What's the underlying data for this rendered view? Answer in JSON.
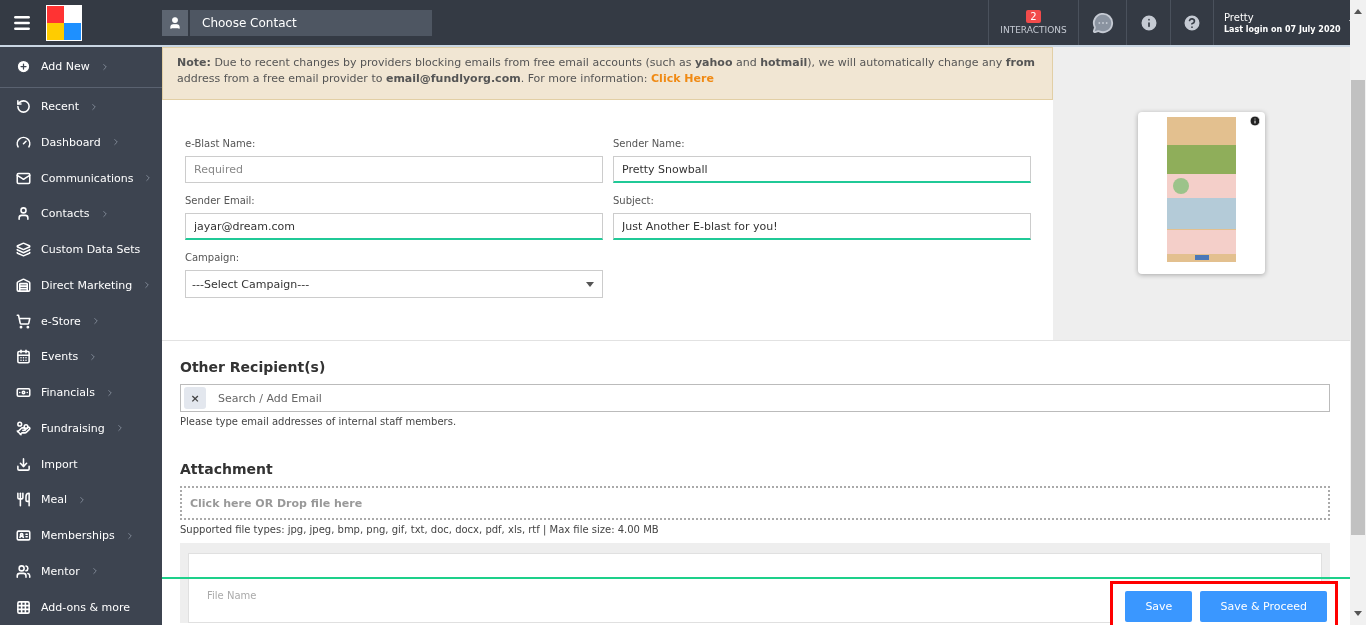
{
  "topbar": {
    "contact_placeholder": "Choose Contact",
    "interactions": {
      "count": "2",
      "label": "INTERACTIONS"
    },
    "user": {
      "name": "Pretty",
      "last_login": "Last login on 07 July 2020"
    }
  },
  "sidebar": {
    "add_new": {
      "label": "Add New",
      "submenu": true
    },
    "items": [
      {
        "label": "Recent",
        "submenu": true
      },
      {
        "label": "Dashboard",
        "submenu": true
      },
      {
        "label": "Communications",
        "submenu": true
      },
      {
        "label": "Contacts",
        "submenu": true
      },
      {
        "label": "Custom Data Sets",
        "submenu": false
      },
      {
        "label": "Direct Marketing",
        "submenu": true
      },
      {
        "label": "e-Store",
        "submenu": true
      },
      {
        "label": "Events",
        "submenu": true
      },
      {
        "label": "Financials",
        "submenu": true
      },
      {
        "label": "Fundraising",
        "submenu": true
      },
      {
        "label": "Import",
        "submenu": false
      },
      {
        "label": "Meal",
        "submenu": true
      },
      {
        "label": "Memberships",
        "submenu": true
      },
      {
        "label": "Mentor",
        "submenu": true
      },
      {
        "label": "Add-ons & more",
        "submenu": false
      }
    ]
  },
  "note": {
    "text": "**Note:** Due to recent changes by providers blocking emails from free email accounts (such as **yahoo** and **hotmail**), we will automatically change any **from** address from a free email provider to **email@fundlyorg.com**. For more information:",
    "link": "Click Here"
  },
  "form": {
    "fields": [
      {
        "kind": "text",
        "label": "e-Blast Name:",
        "placeholder": "Required",
        "valid": false
      },
      {
        "kind": "text",
        "label": "Sender Name:",
        "value": "Pretty Snowball",
        "valid": true
      },
      {
        "kind": "text",
        "label": "Sender Email:",
        "value": "jayar@dream.com",
        "valid": true
      },
      {
        "kind": "text",
        "label": "Subject:",
        "value": "Just Another E-blast for you!",
        "valid": true
      },
      {
        "kind": "select",
        "label": "Campaign:",
        "value": "---Select Campaign---",
        "valid": false
      }
    ]
  },
  "recipients": {
    "title": "Other Recipient(s)",
    "placeholder": "Search / Add Email",
    "clear": "×",
    "help": "Please type email addresses of internal staff members."
  },
  "attachment": {
    "title": "Attachment",
    "dropzone": "Click here OR Drop file here",
    "help": "Supported file types: jpg, jpeg, bmp, png, gif, txt, doc, docx, pdf, xls, rtf | Max file size: 4.00 MB",
    "table_header": "File Name"
  },
  "footer": {
    "buttons": [
      "Save",
      "Save & Proceed"
    ]
  }
}
